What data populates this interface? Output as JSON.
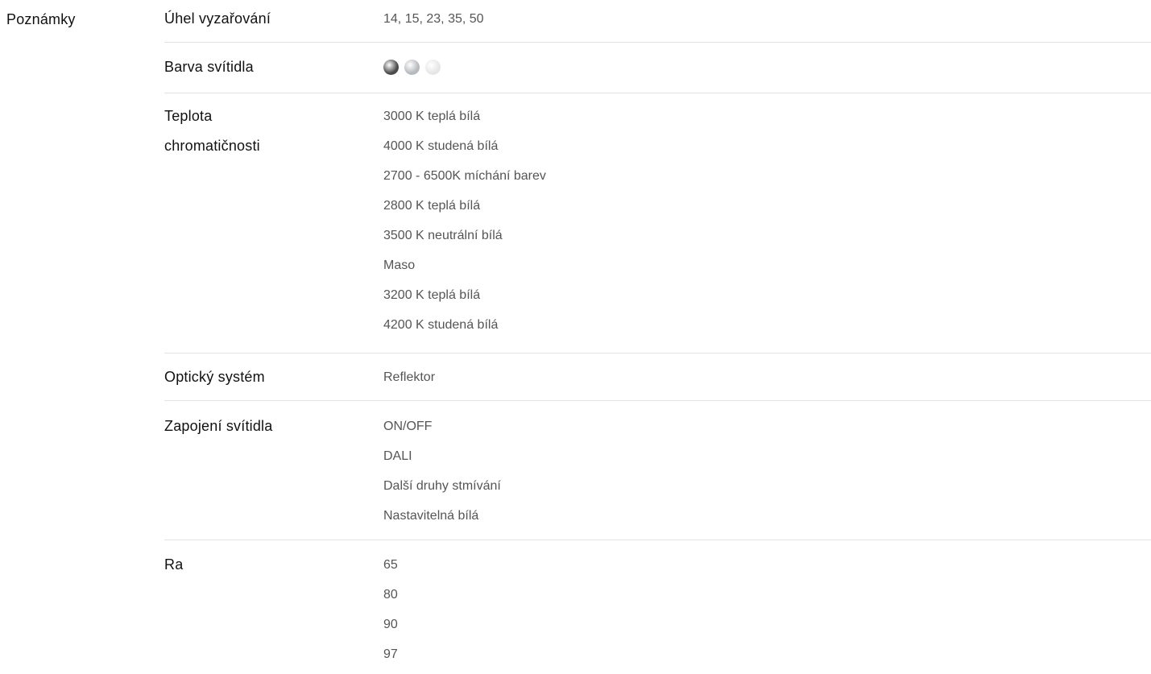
{
  "section": {
    "title": "Poznámky"
  },
  "specs": {
    "beam_angle": {
      "label": "Úhel vyzařování",
      "value": "14, 15, 23, 35, 50"
    },
    "luminaire_color": {
      "label": "Barva svítidla",
      "swatches": [
        {
          "name": "dark-gray",
          "color": "#4a4a4a"
        },
        {
          "name": "silver",
          "color": "#b6b9bd"
        },
        {
          "name": "white",
          "color": "#e6e6e6"
        }
      ]
    },
    "color_temperature": {
      "label_line1": "Teplota",
      "label_line2": "chromatičnosti",
      "values": [
        "3000 K teplá bílá",
        "4000 K studená bílá",
        "2700 - 6500K míchání barev",
        "2800 K teplá bílá",
        "3500 K neutrální bílá",
        "Maso",
        "3200 K teplá bílá",
        "4200 K studená bílá"
      ]
    },
    "optical_system": {
      "label": "Optický systém",
      "value": "Reflektor"
    },
    "connection": {
      "label": "Zapojení svítidla",
      "values": [
        "ON/OFF",
        "DALI",
        "Další druhy stmívání",
        "Nastavitelná bílá"
      ]
    },
    "ra": {
      "label": "Ra",
      "values": [
        "65",
        "80",
        "90",
        "97"
      ]
    }
  }
}
